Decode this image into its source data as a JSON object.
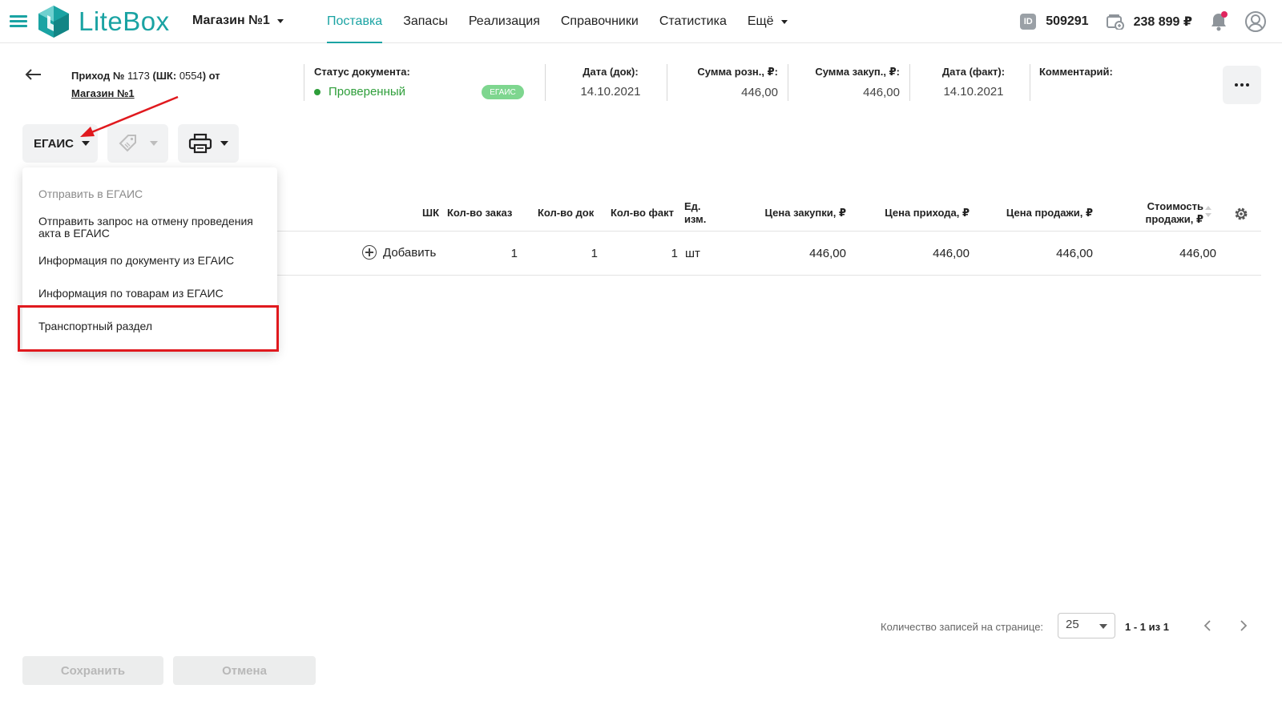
{
  "header": {
    "logo_text": "LiteBox",
    "store": "Магазин №1",
    "nav": [
      "Поставка",
      "Запасы",
      "Реализация",
      "Справочники",
      "Статистика",
      "Ещё"
    ],
    "id_badge": "ID",
    "account_id": "509291",
    "balance": "238 899 ₽"
  },
  "document": {
    "title_bold": "Приход №",
    "title_number": "1173",
    "title_mid": "(ШК:",
    "title_code": "0554",
    "title_end": ") от",
    "store_link": "Магазин №1",
    "status_label": "Статус документа:",
    "status_value": "Проверенный",
    "egais_chip": "ЕГАИС",
    "date_doc_label": "Дата (док):",
    "date_doc_value": "14.10.2021",
    "sum_retail_label": "Сумма розн., ₽:",
    "sum_retail_value": "446,00",
    "sum_purchase_label": "Сумма закуп., ₽:",
    "sum_purchase_value": "446,00",
    "date_fact_label": "Дата (факт):",
    "date_fact_value": "14.10.2021",
    "comment_label": "Комментарий:"
  },
  "toolbar": {
    "egais_label": "ЕГАИС"
  },
  "dropdown": {
    "items": [
      "Отправить в ЕГАИС",
      "Отправить запрос на отмену проведения акта в ЕГАИС",
      "Информация по документу из ЕГАИС",
      "Информация по товарам из ЕГАИС",
      "Транспортный раздел"
    ]
  },
  "table": {
    "headers": {
      "barcode": "ШК",
      "qty_order": "Кол-во заказ",
      "qty_doc": "Кол-во док",
      "qty_fact": "Кол-во факт",
      "unit": "Ед. изм.",
      "price_purchase": "Цена закупки, ₽",
      "price_income": "Цена прихода, ₽",
      "price_sale": "Цена продажи, ₽",
      "sale_cost": "Стоимость продажи, ₽"
    },
    "row": {
      "add_label": "Добавить",
      "qty_order": "1",
      "qty_doc": "1",
      "qty_fact": "1",
      "unit": "шт",
      "price_purchase": "446,00",
      "price_income": "446,00",
      "price_sale": "446,00",
      "sale_cost": "446,00"
    }
  },
  "pagination": {
    "label": "Количество записей на странице:",
    "page_size": "25",
    "range": "1 - 1 из 1"
  },
  "footer": {
    "save_label": "Сохранить",
    "cancel_label": "Отмена"
  },
  "colors": {
    "accent": "#1aa3a3",
    "status_green": "#2e9e3a",
    "chip_green": "#7ed68f",
    "annotation_red": "#e0191e"
  }
}
